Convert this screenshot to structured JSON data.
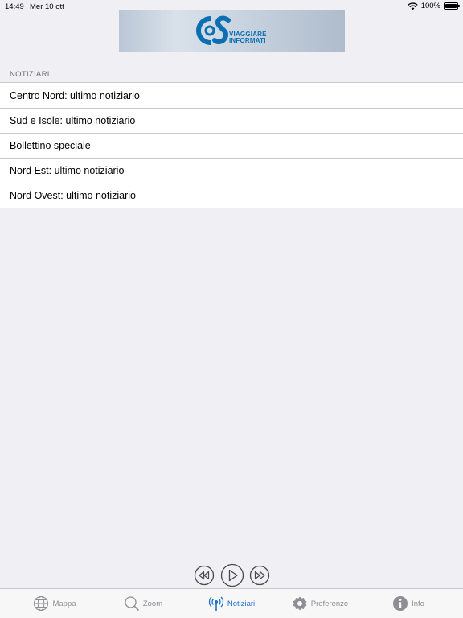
{
  "status_bar": {
    "time": "14:49",
    "date": "Mer 10 ott",
    "battery": "100%",
    "battery_level": 1.0
  },
  "banner": {
    "line1": "VIAGGIARE",
    "line2": "INFORMATI",
    "brand_color": "#0b6fb3"
  },
  "section": {
    "header": "NOTIZIARI"
  },
  "list": {
    "items": [
      {
        "label": "Centro Nord: ultimo notiziario"
      },
      {
        "label": "Sud e Isole: ultimo notiziario"
      },
      {
        "label": "Bollettino speciale"
      },
      {
        "label": "Nord Est: ultimo notiziario"
      },
      {
        "label": "Nord Ovest: ultimo notiziario"
      }
    ]
  },
  "player": {
    "icons": [
      "rewind-icon",
      "play-icon",
      "fast-forward-icon"
    ]
  },
  "tabs": [
    {
      "label": "Mappa",
      "icon": "globe-icon",
      "active": false
    },
    {
      "label": "Zoom",
      "icon": "magnifier-icon",
      "active": false
    },
    {
      "label": "Notiziari",
      "icon": "broadcast-icon",
      "active": true
    },
    {
      "label": "Preferenze",
      "icon": "gear-icon",
      "active": false
    },
    {
      "label": "Info",
      "icon": "info-icon",
      "active": false
    }
  ],
  "colors": {
    "accent": "#1a73c8",
    "inactive": "#8e8e93",
    "background": "#efeff4"
  }
}
